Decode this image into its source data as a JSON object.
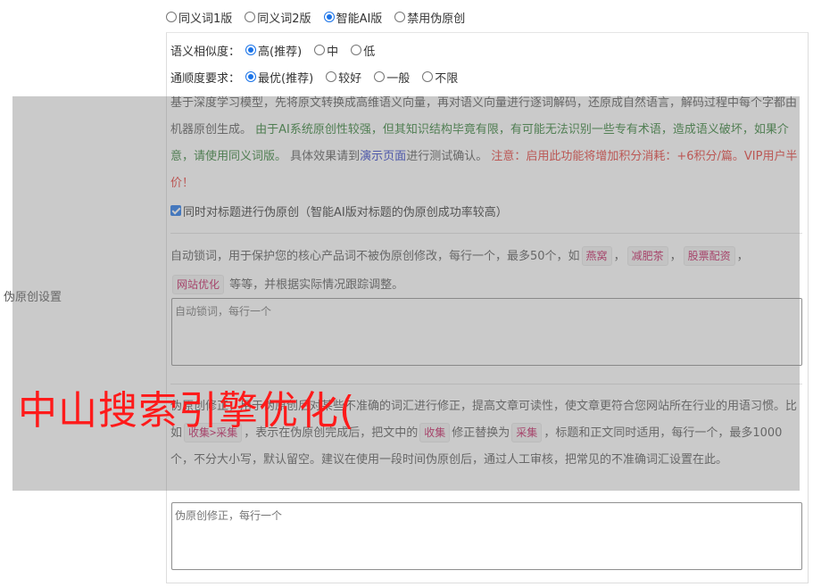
{
  "version_options": {
    "options": [
      {
        "label": "同义词1版",
        "selected": false
      },
      {
        "label": "同义词2版",
        "selected": false
      },
      {
        "label": "智能AI版",
        "selected": true
      },
      {
        "label": "禁用伪原创",
        "selected": false
      }
    ]
  },
  "similarity": {
    "title": "语义相似度：",
    "options": [
      {
        "label": "高(推荐)",
        "selected": true
      },
      {
        "label": "中",
        "selected": false
      },
      {
        "label": "低",
        "selected": false
      }
    ]
  },
  "fluency": {
    "title": "通顺度要求：",
    "options": [
      {
        "label": "最优(推荐)",
        "selected": true
      },
      {
        "label": "较好",
        "selected": false
      },
      {
        "label": "一般",
        "selected": false
      },
      {
        "label": "不限",
        "selected": false
      }
    ]
  },
  "description": {
    "part1": "基于深度学习模型，先将原文转换成高维语义向量，再对语义向量进行逐词解码，还原成自然语言，解码过程中每个字都由机器原创生成。",
    "green_text": "由于AI系统原创性较强，但其知识结构毕竟有限，有可能无法识别一些专有术语，造成语义破坏，如果介意，请使用同义词版。",
    "part2": "具体效果请到",
    "link_text": "演示页面",
    "part3": "进行测试确认。",
    "red_text": "注意：启用此功能将增加积分消耗：+6积分/篇。VIP用户半价！"
  },
  "title_checkbox": {
    "checked": true,
    "label": "同时对标题进行伪原创（智能AI版对标题的伪原创成功率较高）"
  },
  "lock_words": {
    "intro": "自动锁词，用于保护您的核心产品词不被伪原创修改，每行一个，最多50个，如",
    "examples": [
      "燕窝",
      "减肥茶",
      "股票配资",
      "网站优化"
    ],
    "sep": "，",
    "outro": "等等，并根据实际情况跟踪调整。",
    "placeholder": "自动锁词，每行一个"
  },
  "correction": {
    "intro": "伪原创修正，用于伪原创后对某些不准确的词汇进行修正，提高文章可读性，使文章更符合您网站所在行业的用语习惯。比如",
    "example_rule": "收集>采集",
    "mid1": "，表示在伪原创完成后，把文中的",
    "word_from": "收集",
    "mid2": "修正替换为",
    "word_to": "采集",
    "outro": "，标题和正文同时适用，每行一个，最多1000个，不分大小写，默认留空。建议在使用一段时间伪原创后，通过人工审核，把常见的不准确词汇设置在此。",
    "placeholder": "伪原创修正，每行一个"
  },
  "side_label": "伪原创设置",
  "watermark": "中山搜索引擎优化(",
  "colors": {
    "accent": "#1a73e8",
    "green": "#2e7d32",
    "red": "#e53935",
    "link": "#2a3cc7",
    "watermark": "#ff1a1a"
  }
}
